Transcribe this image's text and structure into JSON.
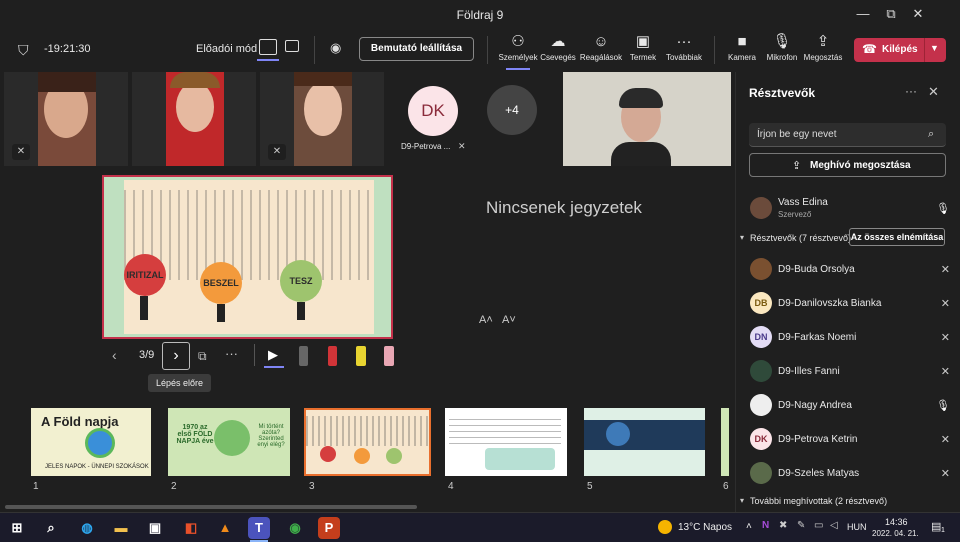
{
  "window": {
    "title": "Földraj 9",
    "controls": [
      "—",
      "⧉",
      "✕"
    ]
  },
  "meeting": {
    "time": "-19:21:30",
    "presenter_mode_label": "Előadói mód",
    "stop_presenting": "Bemutató leállítása",
    "tools": [
      {
        "label": "Személyek",
        "icon": "people-icon"
      },
      {
        "label": "Csevegés",
        "icon": "chat-icon"
      },
      {
        "label": "Reagálások",
        "icon": "reactions-icon"
      },
      {
        "label": "Termek",
        "icon": "rooms-icon"
      },
      {
        "label": "Továbbiak",
        "icon": "more-icon"
      }
    ],
    "devices": [
      {
        "label": "Kamera",
        "icon": "camera-icon"
      },
      {
        "label": "Mikrofon",
        "icon": "microphone-icon"
      },
      {
        "label": "Megosztás",
        "icon": "share-icon"
      }
    ],
    "leave": "Kilépés"
  },
  "stage": {
    "tile_dk_initials": "DK",
    "tile_dk_name": "D9-Petrova ...",
    "more_count": "+4",
    "notes_empty": "Nincsenek jegyzetek",
    "font_decrease": "A˄",
    "font_increase": "A˅",
    "slide_counter": "3/9",
    "tooltip": "Lépés előre",
    "main_slide_words": [
      "IRITIZAL",
      "BESZEL",
      "TESZ"
    ]
  },
  "thumbnails": [
    {
      "num": "1",
      "title": "A Föld napja",
      "sub": "JELES NAPOK - ÜNNEPI SZOKÁSOK"
    },
    {
      "num": "2",
      "title": "1970 az első FÖLD NAPJA éve",
      "sub": "Mi történt azóta? Szerinted enyi elég?"
    },
    {
      "num": "3",
      "title": "",
      "sub": ""
    },
    {
      "num": "4",
      "title": "",
      "sub": ""
    },
    {
      "num": "5",
      "title": "",
      "sub": ""
    },
    {
      "num": "6",
      "title": "",
      "sub": ""
    }
  ],
  "panel": {
    "title": "Résztvevők",
    "search_placeholder": "Írjon be egy nevet",
    "invite": "Meghívó megosztása",
    "organizer": {
      "name": "Vass Edina",
      "role": "Szervező"
    },
    "section_label": "Résztvevők (7 résztvevő)",
    "mute_all": "Az összes elnémítása",
    "participants": [
      {
        "name": "D9-Buda Orsolya",
        "initials": "",
        "muted": true
      },
      {
        "name": "D9-Danilovszka Bianka",
        "initials": "DB",
        "muted": true
      },
      {
        "name": "D9-Farkas Noemi",
        "initials": "DN",
        "muted": true
      },
      {
        "name": "D9-Illes Fanni",
        "initials": "",
        "muted": true
      },
      {
        "name": "D9-Nagy Andrea",
        "initials": "",
        "muted": false
      },
      {
        "name": "D9-Petrova Ketrin",
        "initials": "DK",
        "muted": true
      },
      {
        "name": "D9-Szeles Matyas",
        "initials": "",
        "muted": true
      }
    ],
    "invited_label": "További meghívottak (2 résztvevő)"
  },
  "taskbar": {
    "weather": "13°C Napos",
    "lang": "HUN",
    "clock_time": "14:36",
    "clock_date": "2022. 04. 21.",
    "notif_count": "1"
  }
}
